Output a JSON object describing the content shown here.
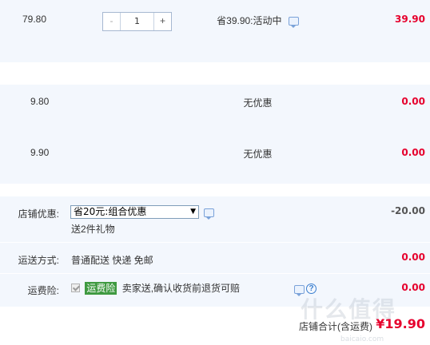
{
  "items": [
    {
      "price": "79.80",
      "quantity": "1",
      "discount": "省39.90:活动中",
      "subtotal": "39.90"
    },
    {
      "price": "9.80",
      "discount": "无优惠",
      "subtotal": "0.00"
    },
    {
      "price": "9.90",
      "discount": "无优惠",
      "subtotal": "0.00"
    }
  ],
  "qty_controls": {
    "minus": "-",
    "plus": "+"
  },
  "store_discount": {
    "label": "店铺优惠:",
    "selected": "省20元:组合优惠",
    "gift": "送2件礼物",
    "amount": "-20.00"
  },
  "shipping": {
    "label": "运送方式:",
    "method": "普通配送 快递 免邮",
    "amount": "0.00"
  },
  "insurance": {
    "label": "运费险:",
    "tag": "运费险",
    "description": "卖家送,确认收货前退货可赔",
    "help": "?",
    "amount": "0.00"
  },
  "total": {
    "label": "店铺合计(含运费)",
    "value": "¥19.90"
  },
  "watermark": {
    "main": "什么值得",
    "sub": "baicaio.com"
  },
  "colors": {
    "price_red": "#e6002d",
    "row_bg": "#f3f7fd",
    "insurance_green": "#3f9a41"
  }
}
